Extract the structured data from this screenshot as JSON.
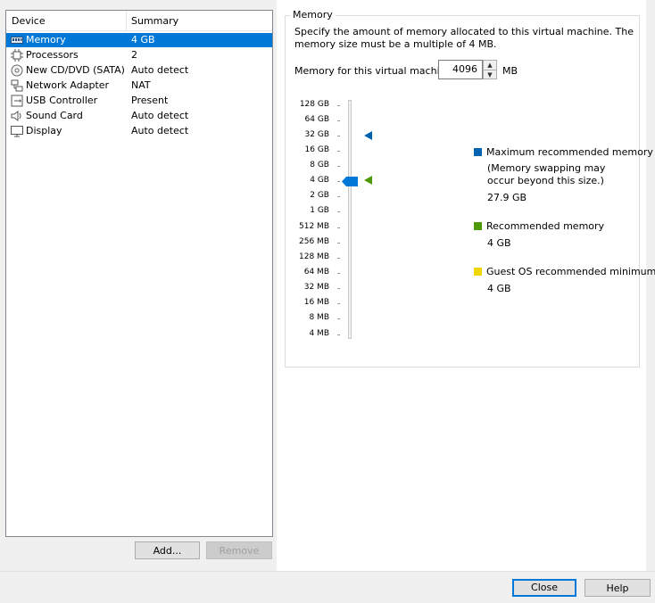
{
  "device_list": {
    "columns": [
      "Device",
      "Summary"
    ],
    "items": [
      {
        "name": "Memory",
        "summary": "4 GB",
        "icon": "memory-icon",
        "selected": true
      },
      {
        "name": "Processors",
        "summary": "2",
        "icon": "processor-icon"
      },
      {
        "name": "New CD/DVD (SATA)",
        "summary": "Auto detect",
        "icon": "cd-dvd-icon"
      },
      {
        "name": "Network Adapter",
        "summary": "NAT",
        "icon": "network-adapter-icon"
      },
      {
        "name": "USB Controller",
        "summary": "Present",
        "icon": "usb-controller-icon"
      },
      {
        "name": "Sound Card",
        "summary": "Auto detect",
        "icon": "sound-card-icon"
      },
      {
        "name": "Display",
        "summary": "Auto detect",
        "icon": "display-icon"
      }
    ],
    "add_button": "Add...",
    "remove_button": "Remove"
  },
  "memory": {
    "group_title": "Memory",
    "description": "Specify the amount of memory allocated to this virtual machine. The memory size must be a multiple of 4 MB.",
    "field_label": "Memory for this virtual machine:",
    "value": "4096",
    "unit": "MB",
    "scale_labels": [
      "128 GB",
      "64 GB",
      "32 GB",
      "16 GB",
      "8 GB",
      "4 GB",
      "2 GB",
      "1 GB",
      "512 MB",
      "256 MB",
      "128 MB",
      "64 MB",
      "32 MB",
      "16 MB",
      "8 MB",
      "4 MB"
    ],
    "current_position": "4 GB",
    "legend": {
      "max": {
        "label": "Maximum recommended memory",
        "note_line1": "(Memory swapping may",
        "note_line2": "occur beyond this size.)",
        "value": "27.9 GB",
        "color": "#0063b1"
      },
      "recommended": {
        "label": "Recommended memory",
        "value": "4 GB",
        "color": "#4e9a06"
      },
      "guest_min": {
        "label": "Guest OS recommended minimum",
        "value": "4 GB",
        "color": "#f2d600"
      }
    }
  },
  "footer": {
    "close_button": "Close",
    "help_button": "Help"
  }
}
